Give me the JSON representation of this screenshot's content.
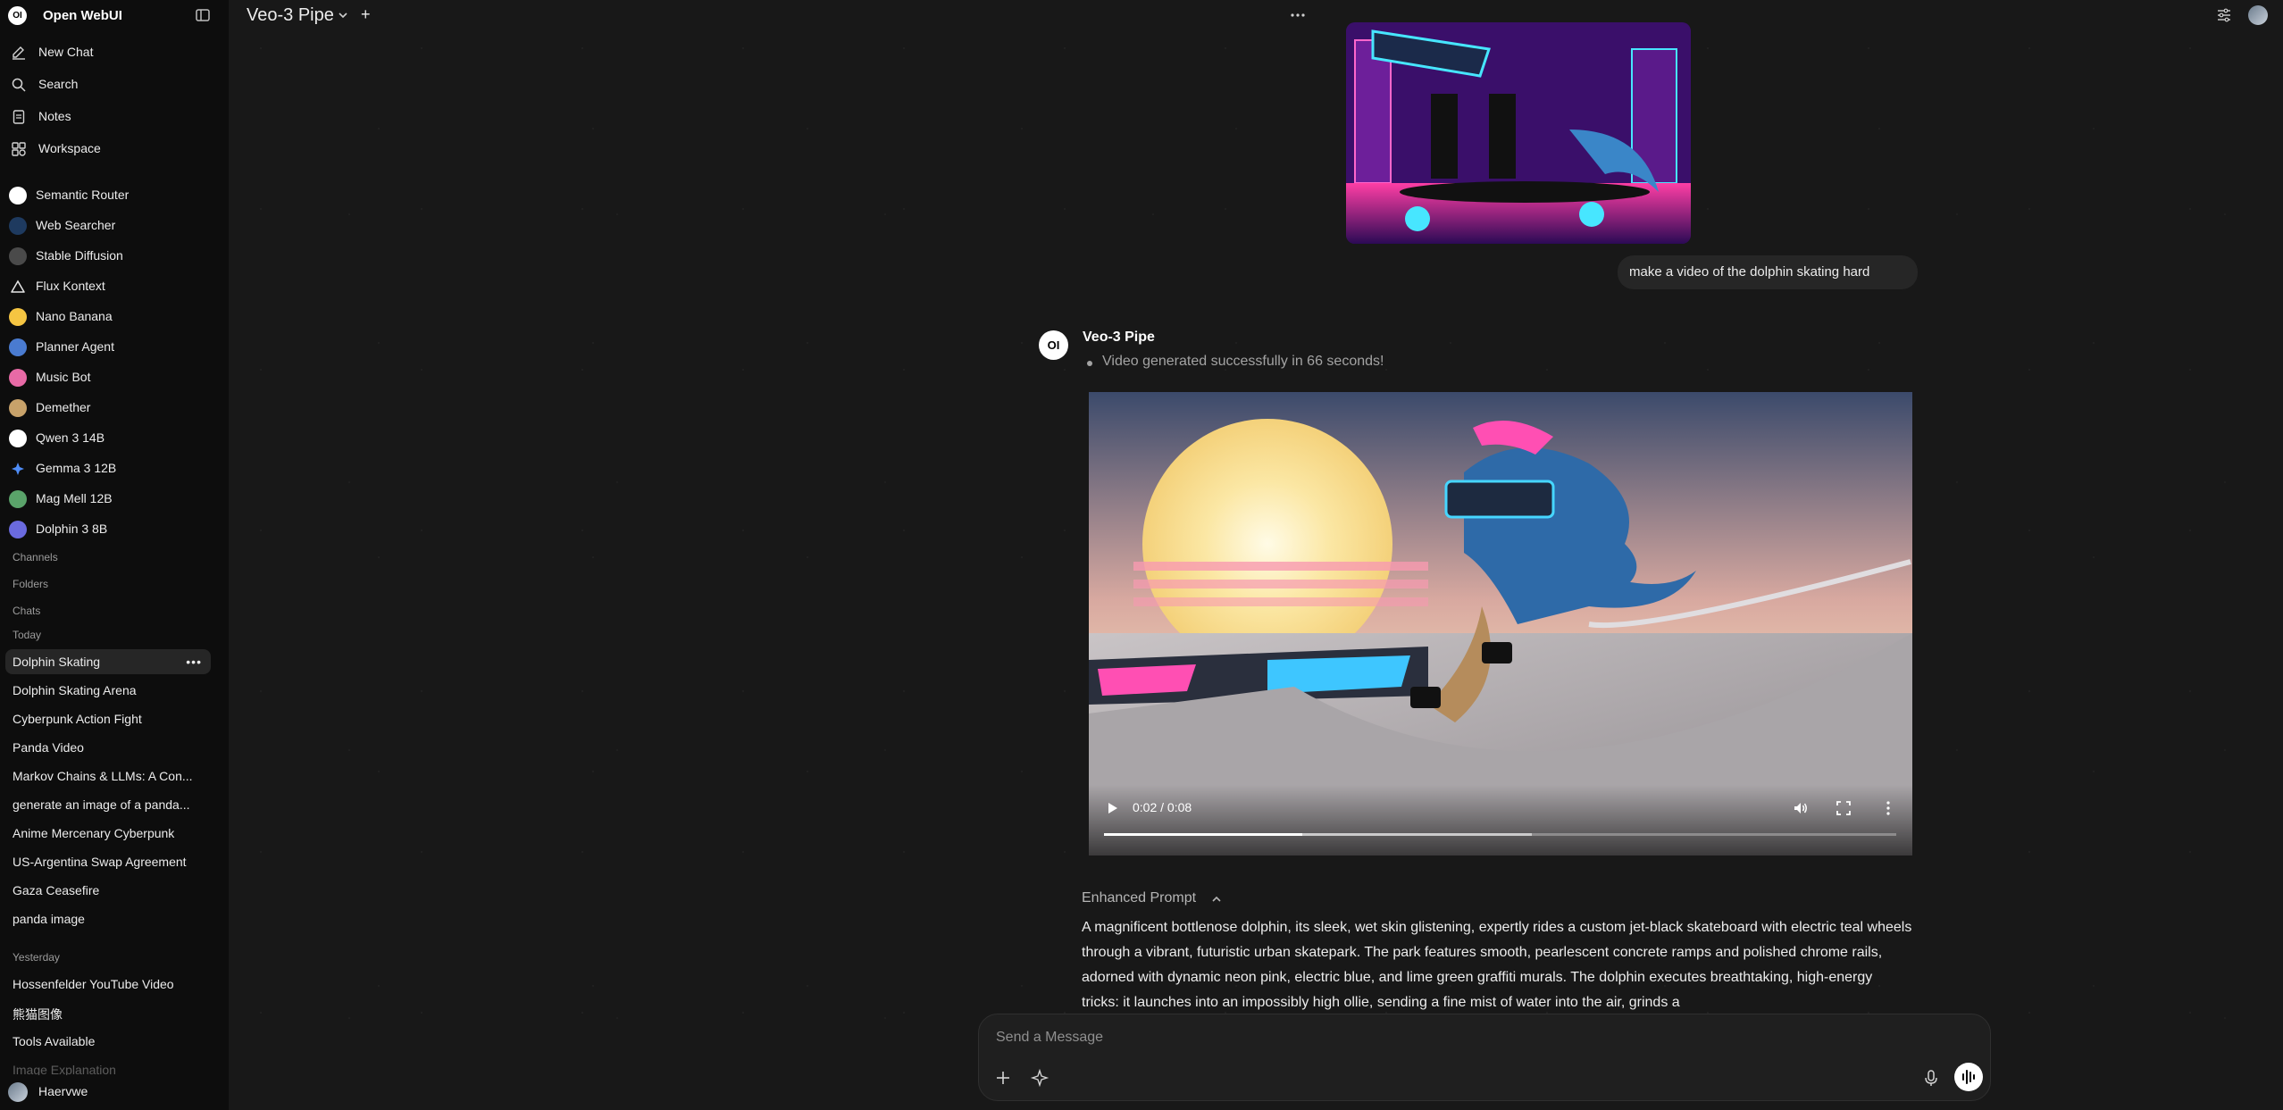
{
  "app": {
    "name": "Open WebUI",
    "logo_text": "OI"
  },
  "sidebar": {
    "nav": [
      {
        "label": "New Chat",
        "icon": "edit-icon"
      },
      {
        "label": "Search",
        "icon": "search-icon"
      },
      {
        "label": "Notes",
        "icon": "notes-icon"
      },
      {
        "label": "Workspace",
        "icon": "workspace-icon"
      }
    ],
    "models": [
      {
        "label": "Semantic Router",
        "color": "#ffffff"
      },
      {
        "label": "Web Searcher",
        "color": "#1e3a5f"
      },
      {
        "label": "Stable Diffusion",
        "color": "#4a4a4a"
      },
      {
        "label": "Flux Kontext",
        "color": "#e5e5e5"
      },
      {
        "label": "Nano Banana",
        "color": "#f5c542"
      },
      {
        "label": "Planner Agent",
        "color": "#4a7bd0"
      },
      {
        "label": "Music Bot",
        "color": "#e86aa6"
      },
      {
        "label": "Demether",
        "color": "#c8a26a"
      },
      {
        "label": "Qwen 3 14B",
        "color": "#ffffff"
      },
      {
        "label": "Gemma 3 12B",
        "color": "#4f8df7"
      },
      {
        "label": "Mag Mell 12B",
        "color": "#5aa36a"
      },
      {
        "label": "Dolphin 3 8B",
        "color": "#6a6adf"
      }
    ],
    "sections": {
      "channels": "Channels",
      "folders": "Folders",
      "chats": "Chats",
      "today": "Today",
      "yesterday": "Yesterday"
    },
    "today_chats": [
      "Dolphin Skating",
      "Dolphin Skating Arena",
      "Cyberpunk Action Fight",
      "Panda Video",
      "Markov Chains & LLMs: A Con...",
      "generate an image of a panda...",
      "Anime Mercenary Cyberpunk",
      "US-Argentina Swap Agreement",
      "Gaza Ceasefire",
      "panda image"
    ],
    "yesterday_chats": [
      "Hossenfelder YouTube Video",
      "熊猫图像",
      "Tools Available",
      "Image Explanation"
    ],
    "active_chat_more": "•••",
    "user": {
      "name": "Haervwe"
    }
  },
  "topbar": {
    "model_title": "Veo-3 Pipe",
    "plus": "+"
  },
  "conversation": {
    "user_message": "make a video of the dolphin skating hard",
    "bot_name": "Veo-3 Pipe",
    "bot_avatar_text": "OI",
    "status": "Video generated successfully in 66 seconds!",
    "video": {
      "time": "0:02 / 0:08",
      "played_fraction": 0.25,
      "buffered_fraction": 0.54
    },
    "enhanced_prompt_label": "Enhanced Prompt",
    "enhanced_prompt": "A magnificent bottlenose dolphin, its sleek, wet skin glistening, expertly rides a custom jet-black skateboard with electric teal wheels through a vibrant, futuristic urban skatepark. The park features smooth, pearlescent concrete ramps and polished chrome rails, adorned with dynamic neon pink, electric blue, and lime green graffiti murals. The dolphin executes breathtaking, high-energy tricks: it launches into an impossibly high ollie, sending a fine mist of water into the air, grinds a"
  },
  "composer": {
    "placeholder": "Send a Message"
  }
}
